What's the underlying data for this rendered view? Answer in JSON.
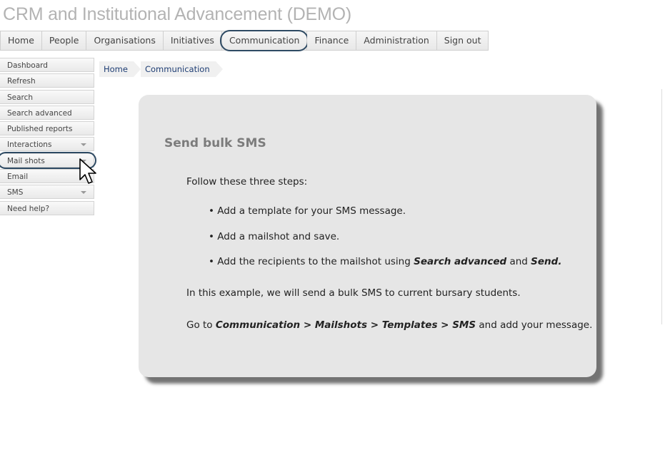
{
  "app": {
    "title": "CRM and Institutional Advancement (DEMO)"
  },
  "topnav": {
    "tabs": [
      "Home",
      "People",
      "Organisations",
      "Initiatives",
      "Communication",
      "Finance",
      "Administration",
      "Sign out"
    ],
    "active": "Communication"
  },
  "sidebar": {
    "items": [
      "Dashboard",
      "Refresh",
      "Search",
      "Search advanced",
      "Published reports",
      "Interactions",
      "Mail shots",
      "Email",
      "SMS",
      "Need help?"
    ],
    "highlighted": "Mail shots"
  },
  "breadcrumb": [
    "Home",
    "Communication"
  ],
  "card": {
    "heading": "Send bulk SMS",
    "intro": "Follow these three steps:",
    "bullets": {
      "b1": "Add a template for your SMS message.",
      "b2": "Add a mailshot and save.",
      "b3_pre": "Add the recipients to the mailshot using",
      "b3_term1": "Search advanced",
      "b3_mid": "and",
      "b3_term2": "Send."
    },
    "example": "In this example, we will send a bulk SMS to current bursary students.",
    "goto_pre": "Go to",
    "goto_path": "Communication > Mailshots > Templates > SMS",
    "goto_post": "and add your message."
  }
}
